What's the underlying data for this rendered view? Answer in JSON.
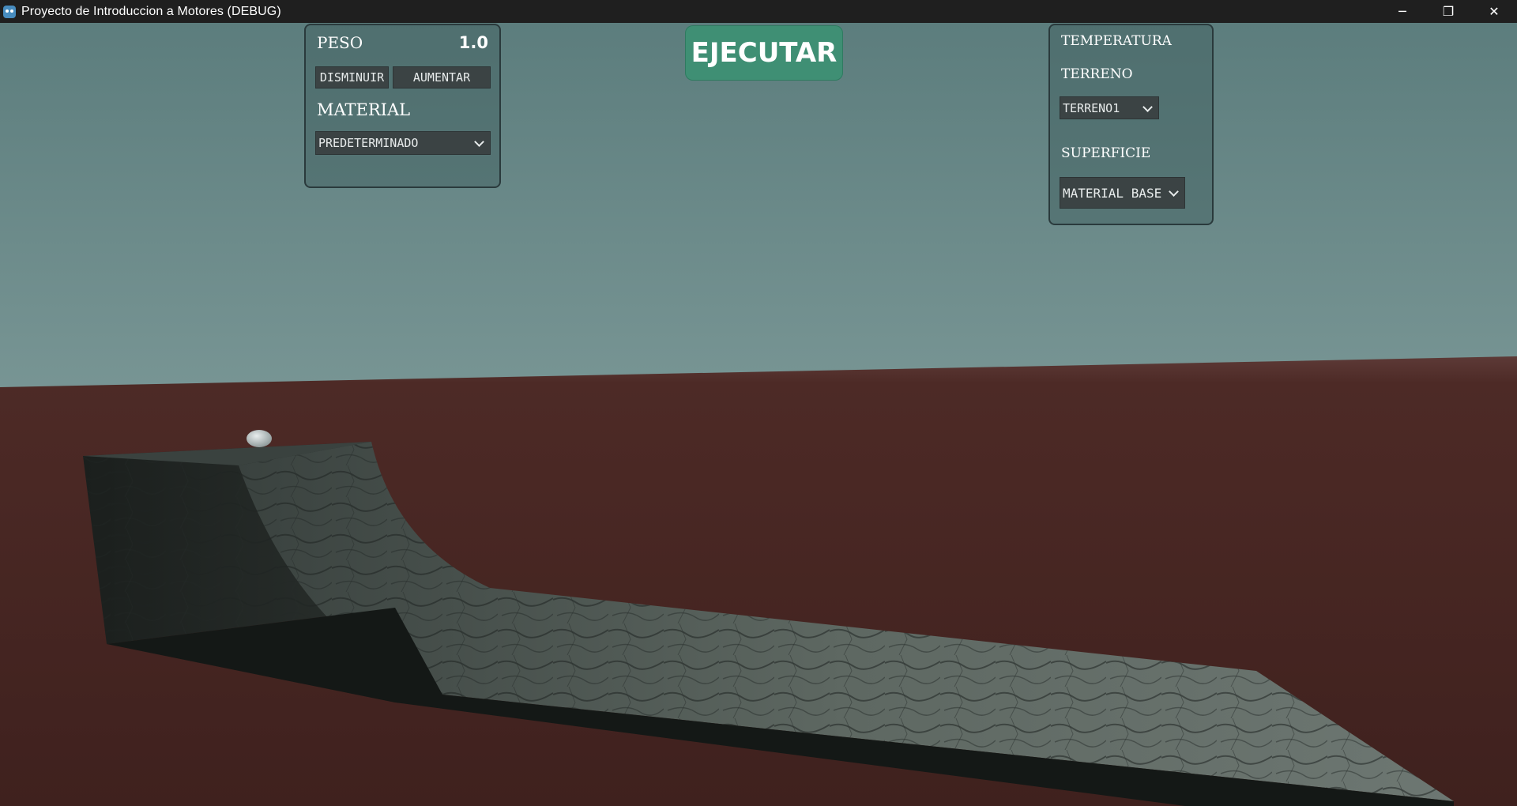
{
  "window": {
    "title": "Proyecto de Introduccion a Motores (DEBUG)",
    "minimize_glyph": "─",
    "restore_glyph": "❐",
    "close_glyph": "✕"
  },
  "left_panel": {
    "weight_label": "PESO",
    "weight_value": "1.0",
    "decrease_label": "DISMINUIR",
    "increase_label": "AUMENTAR",
    "material_label": "MATERIAL",
    "material_selected": "PREDETERMINADO"
  },
  "run_button": {
    "label": "EJECUTAR"
  },
  "right_panel": {
    "temperature_label": "TEMPERATURA",
    "terrain_label": "TERRENO",
    "terrain_selected": "TERRENO1",
    "surface_label": "SUPERFICIE",
    "surface_selected": "MATERIAL BASE"
  },
  "colors": {
    "sky_top": "#5c7d7d",
    "sky_horizon": "#97b0ae",
    "ground": "#3f211e",
    "run_button": "#3f8f74",
    "panel_border": "#2a3a3c"
  }
}
